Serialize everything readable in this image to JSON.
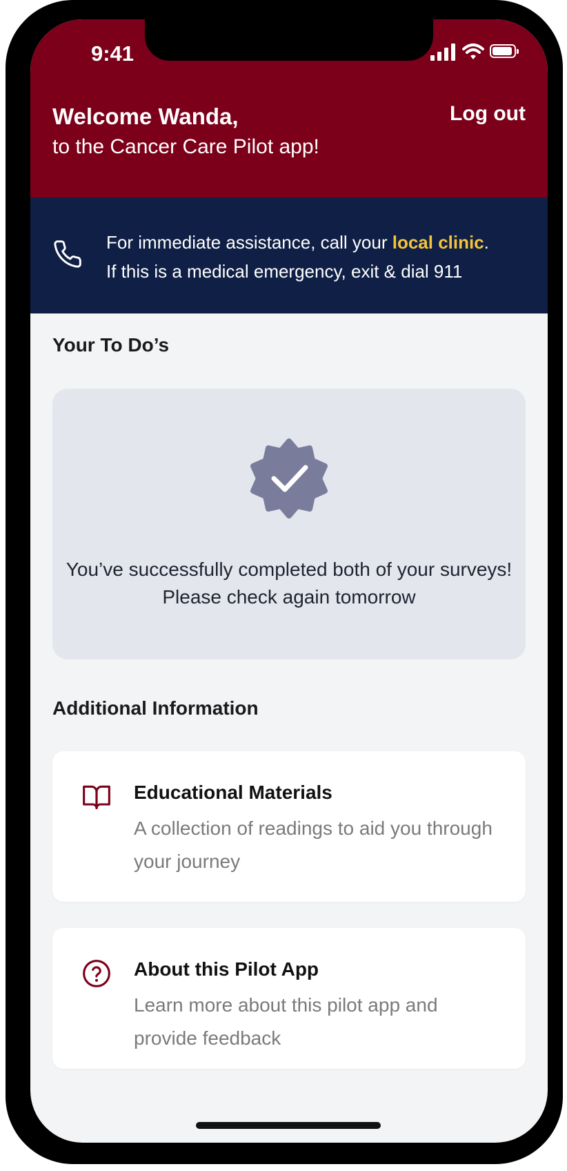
{
  "status_bar": {
    "time": "9:41"
  },
  "header": {
    "welcome": "Welcome Wanda,",
    "subtitle": "to the Cancer Care Pilot app!",
    "logout_label": "Log out"
  },
  "assistance": {
    "line1_prefix": "For immediate assistance, call your ",
    "link_label": "local clinic",
    "line1_suffix": ".",
    "line2": "If this is a medical emergency, exit & dial 911"
  },
  "todos": {
    "title": "Your To Do’s",
    "message": "You’ve successfully completed both of your surveys! Please check again tomorrow"
  },
  "additional": {
    "title": "Additional Information",
    "cards": [
      {
        "icon": "book-icon",
        "title": "Educational Materials",
        "description": "A collection of readings to aid you through your journey"
      },
      {
        "icon": "question-circle-icon",
        "title": "About this Pilot App",
        "description": "Learn more about this pilot app and provide feedback"
      }
    ]
  },
  "colors": {
    "header_bg": "#7c0019",
    "banner_bg": "#0f1f45",
    "link_yellow": "#f5c33b",
    "verified_badge": "#7a7c9c",
    "icon_maroon": "#7c0019"
  }
}
